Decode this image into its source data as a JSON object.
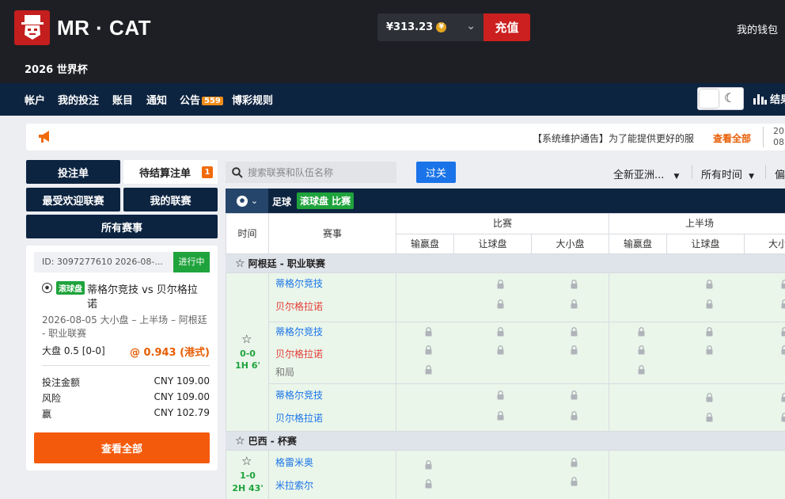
{
  "header": {
    "brand": "MR · CAT",
    "balance": "¥313.23",
    "coin_symbol": "¥",
    "deposit_label": "充值",
    "wallet_label": "我的钱包",
    "event_title": "2026 世界杯"
  },
  "nav": {
    "items": [
      "帐户",
      "我的投注",
      "账目",
      "通知",
      "公告",
      "博彩规则"
    ],
    "announcement_badge": "559",
    "results_label": "结果"
  },
  "notice": {
    "text": "【系统维护通告】为了能提供更好的服",
    "view_all": "查看全部",
    "date_line1": "20",
    "date_line2": "08:"
  },
  "sidebar": {
    "bet_slip": "投注单",
    "pending": "待结算注单",
    "pending_count": "1",
    "popular_leagues": "最受欢迎联赛",
    "my_leagues": "我的联赛",
    "all_events": "所有赛事"
  },
  "slip": {
    "id_line": "ID: 3097277610    2026-08-...",
    "status": "进行中",
    "live_tag": "滚球盘",
    "match_line1": "蒂格尔竞技 vs 贝尔格拉",
    "match_line2": "诺",
    "detail_line1": "2026-08-05 大小盘 – 上半场 – 阿根廷",
    "detail_line2": "- 职业联赛",
    "selection": "大盘 0.5 [0-0]",
    "odds": "@ 0.943 (港式)",
    "stake_label": "投注金额",
    "stake_value": "CNY 109.00",
    "risk_label": "风险",
    "risk_value": "CNY 109.00",
    "win_label": "赢",
    "win_value": "CNY 102.79",
    "view_all": "查看全部"
  },
  "toolbar": {
    "search_placeholder": "搜索联赛和队伍名称",
    "parlay_label": "过关",
    "market_filter": "全新亚洲...",
    "time_filter": "所有时间",
    "pref_filter": "偏"
  },
  "sport": {
    "label": "足球",
    "live_label": "滚球盘 比赛"
  },
  "table": {
    "col_time": "时间",
    "col_event": "赛事",
    "group_full": "比赛",
    "group_half": "上半场",
    "sub_cols": [
      "输赢盘",
      "让球盘",
      "大小盘",
      "输赢盘",
      "让球盘",
      "大小"
    ]
  },
  "leagues": [
    {
      "name": "阿根廷 - 职业联赛",
      "match": {
        "score": "0-0",
        "time": "1H 6'",
        "rows": [
          [
            "蒂格尔竞技",
            "贝尔格拉诺"
          ],
          [
            "蒂格尔竞技",
            "贝尔格拉诺",
            "和局"
          ],
          [
            "蒂格尔竞技",
            "贝尔格拉诺"
          ]
        ]
      }
    },
    {
      "name": "巴西 - 杯赛",
      "match": {
        "score": "1-0",
        "time": "2H 43'",
        "rows": [
          [
            "格雷米奥",
            "米拉索尔"
          ]
        ]
      }
    }
  ]
}
